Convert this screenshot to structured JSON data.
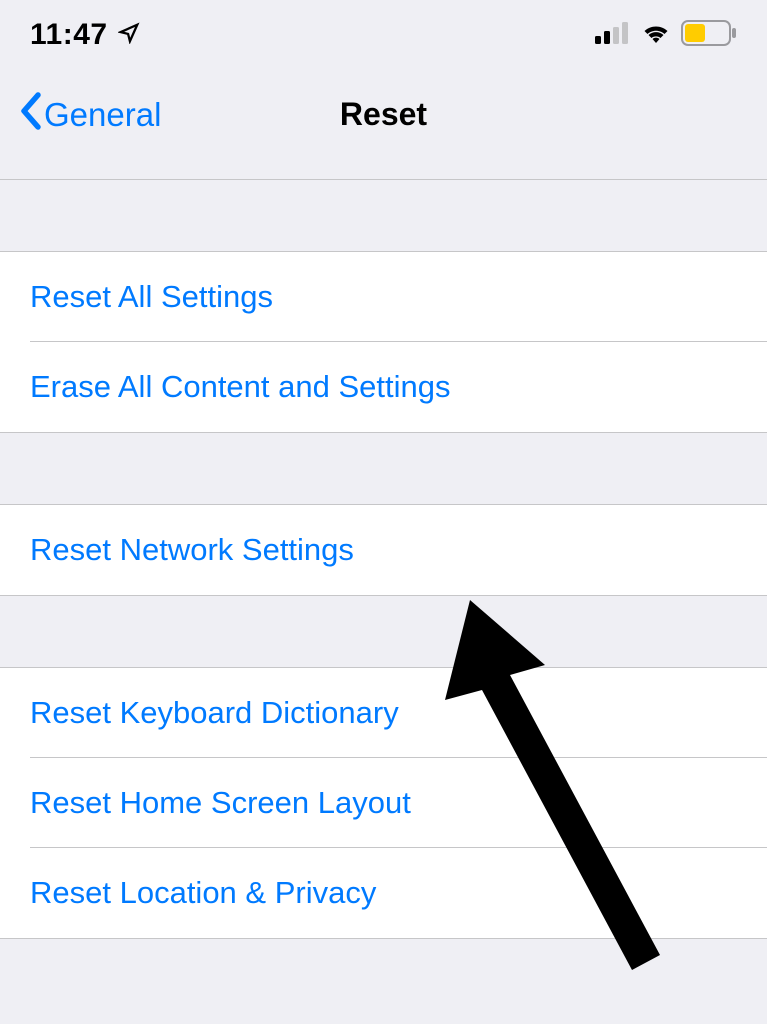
{
  "status": {
    "time": "11:47"
  },
  "nav": {
    "back_label": "General",
    "title": "Reset"
  },
  "groups": [
    {
      "items": [
        {
          "label": "Reset All Settings"
        },
        {
          "label": "Erase All Content and Settings"
        }
      ]
    },
    {
      "items": [
        {
          "label": "Reset Network Settings"
        }
      ]
    },
    {
      "items": [
        {
          "label": "Reset Keyboard Dictionary"
        },
        {
          "label": "Reset Home Screen Layout"
        },
        {
          "label": "Reset Location & Privacy"
        }
      ]
    }
  ]
}
